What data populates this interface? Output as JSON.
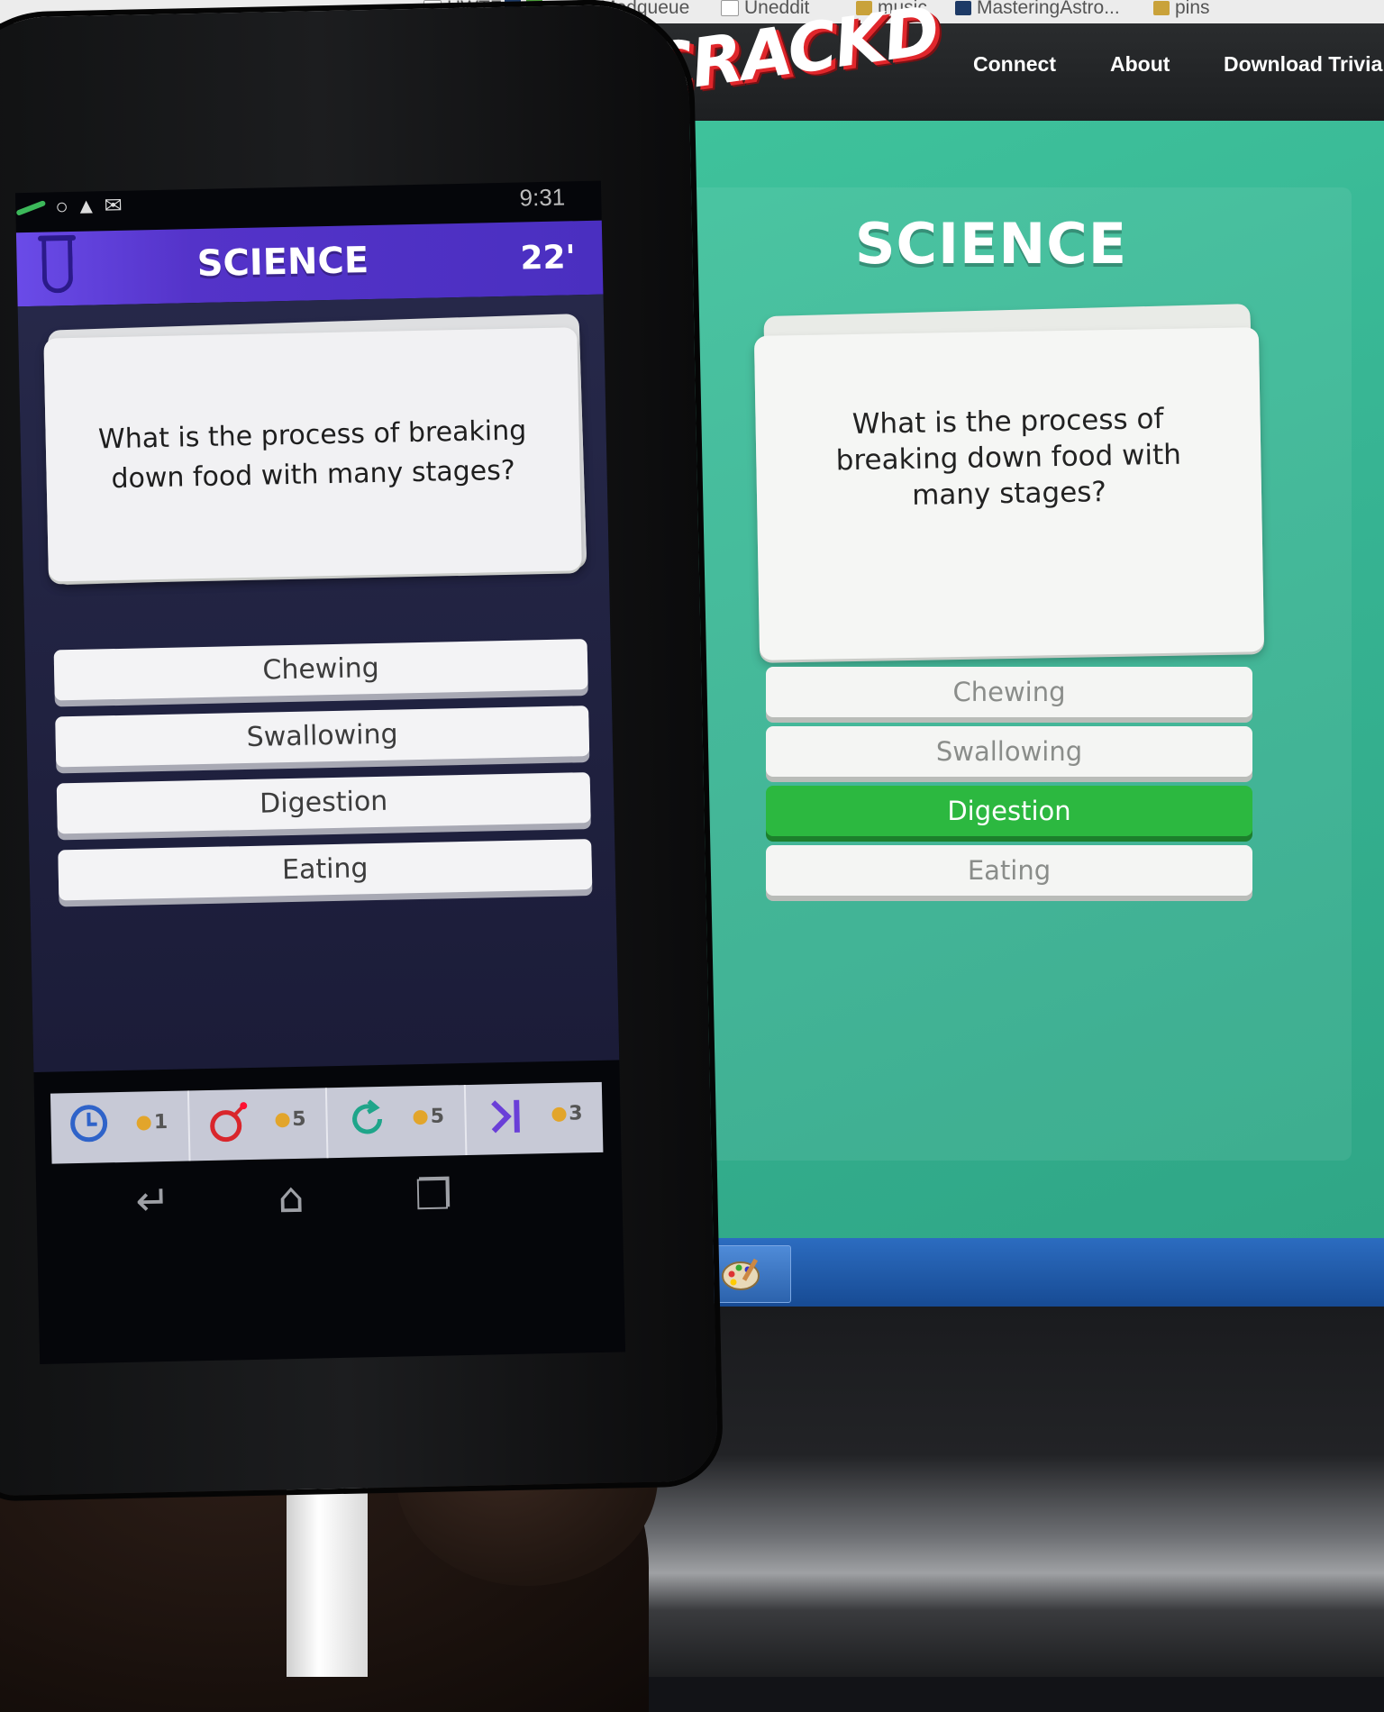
{
  "browser": {
    "bookmarks": [
      "HWTF",
      "Modqueue",
      "Uneddit",
      "music",
      "MasteringAstro...",
      "pins"
    ]
  },
  "website": {
    "logo": "CRACKD",
    "nav": [
      "Connect",
      "About",
      "Download Trivia"
    ],
    "category": "SCIENCE",
    "question": "What is the process of breaking down food with many stages?",
    "answers": [
      "Chewing",
      "Swallowing",
      "Digestion",
      "Eating"
    ],
    "correct_answer_index": 2,
    "colors": {
      "background": "#37b493",
      "correct": "#2cb840"
    }
  },
  "phone": {
    "status_time": "9:31",
    "category": "SCIENCE",
    "timer": "22'",
    "question": "What is the process of breaking down food with many stages?",
    "answers": [
      "Chewing",
      "Swallowing",
      "Digestion",
      "Eating"
    ],
    "powerups": [
      {
        "icon": "clock-icon",
        "cost": "1"
      },
      {
        "icon": "bomb-icon",
        "cost": "5"
      },
      {
        "icon": "refresh-icon",
        "cost": "5"
      },
      {
        "icon": "skip-icon",
        "cost": "3"
      }
    ],
    "colors": {
      "header": "#5433c9",
      "body": "#262849"
    }
  }
}
